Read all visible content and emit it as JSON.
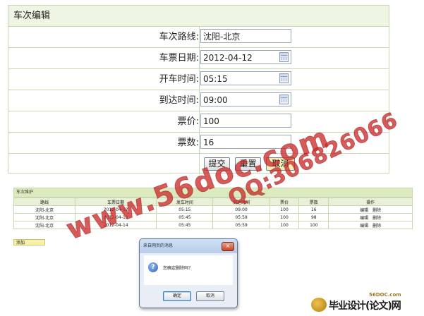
{
  "edit_form": {
    "title": "车次编辑",
    "fields": [
      {
        "label": "车次路线:",
        "value": "沈阳-北京",
        "calendar": false
      },
      {
        "label": "车票日期:",
        "value": "2012-04-12",
        "calendar": true
      },
      {
        "label": "开车时间:",
        "value": "05:15",
        "calendar": true
      },
      {
        "label": "到达时间:",
        "value": "09:00",
        "calendar": true
      },
      {
        "label": "票价:",
        "value": "100",
        "calendar": false
      },
      {
        "label": "票数:",
        "value": "16",
        "calendar": false
      }
    ],
    "buttons": {
      "submit": "提交",
      "reset": "重置",
      "cancel": "取消"
    }
  },
  "list": {
    "title": "车次维护",
    "columns": [
      "路线",
      "车票日期",
      "发车时间",
      "到达时间",
      "票价",
      "票数",
      "操作"
    ],
    "rows": [
      {
        "route": "沈阳-北京",
        "date": "2012-04-12",
        "depart": "05:15",
        "arrive": "09:00",
        "price": "100",
        "count": "16",
        "edit": "编辑",
        "delete": "删除"
      },
      {
        "route": "沈阳-北京",
        "date": "2012-04-13",
        "depart": "05:45",
        "arrive": "05:59",
        "price": "100",
        "count": "98",
        "edit": "编辑",
        "delete": "删除"
      },
      {
        "route": "沈阳-北京",
        "date": "2012-04-14",
        "depart": "05:45",
        "arrive": "05:59",
        "price": "100",
        "count": "100",
        "edit": "编辑",
        "delete": "删除"
      }
    ],
    "add_label": "添加"
  },
  "dialog": {
    "title": "来自网页的消息",
    "close": "×",
    "message": "您确定删除吗？",
    "ok": "确定",
    "cancel": "取消"
  },
  "watermarks": {
    "site": "www.56doc.com",
    "qq": "QQ:306826066"
  },
  "logo": {
    "url": "56DOC.com",
    "text": "毕业设计(论文)网"
  },
  "colors": {
    "border": "#c9d8b3",
    "header_bg": "#eef5e2",
    "watermark": "#cd2d2d"
  }
}
